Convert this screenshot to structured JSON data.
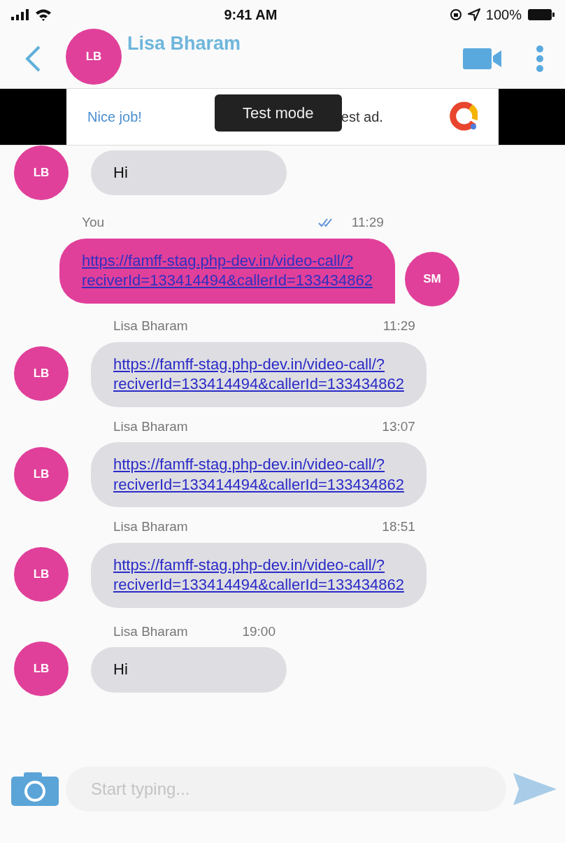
{
  "status_bar": {
    "time": "9:41 AM",
    "battery": "100%"
  },
  "header": {
    "avatar": "LB",
    "title": "Lisa Bharam"
  },
  "ad": {
    "text": "Nice job!",
    "text_2": "est ad.",
    "tooltip": "Test mode"
  },
  "messages": [
    {
      "kind": "incoming",
      "avatar": "LB",
      "text_lines": [
        "Hi"
      ],
      "link": false
    },
    {
      "kind": "outgoing",
      "avatar": "SM",
      "sender": "You",
      "time": "11:29",
      "read": true,
      "text_lines": [
        "https://famff-stag.php-dev.in/video-call/?",
        "reciverId=133414494&callerId=133434862"
      ],
      "link": true
    },
    {
      "kind": "incoming",
      "avatar": "LB",
      "sender": "Lisa Bharam",
      "time": "11:29",
      "text_lines": [
        "https://famff-stag.php-dev.in/video-call/?",
        "reciverId=133414494&callerId=133434862"
      ],
      "link": true
    },
    {
      "kind": "incoming",
      "avatar": "LB",
      "sender": "Lisa Bharam",
      "time": "13:07",
      "text_lines": [
        "https://famff-stag.php-dev.in/video-call/?",
        "reciverId=133414494&callerId=133434862"
      ],
      "link": true
    },
    {
      "kind": "incoming",
      "avatar": "LB",
      "sender": "Lisa Bharam",
      "time": "18:51",
      "text_lines": [
        "https://famff-stag.php-dev.in/video-call/?",
        "reciverId=133414494&callerId=133434862"
      ],
      "link": true
    },
    {
      "kind": "incoming",
      "avatar": "LB",
      "sender": "Lisa Bharam",
      "time": "19:00",
      "text_lines": [
        "Hi"
      ],
      "link": false
    }
  ],
  "composer": {
    "placeholder": "Start typing..."
  }
}
